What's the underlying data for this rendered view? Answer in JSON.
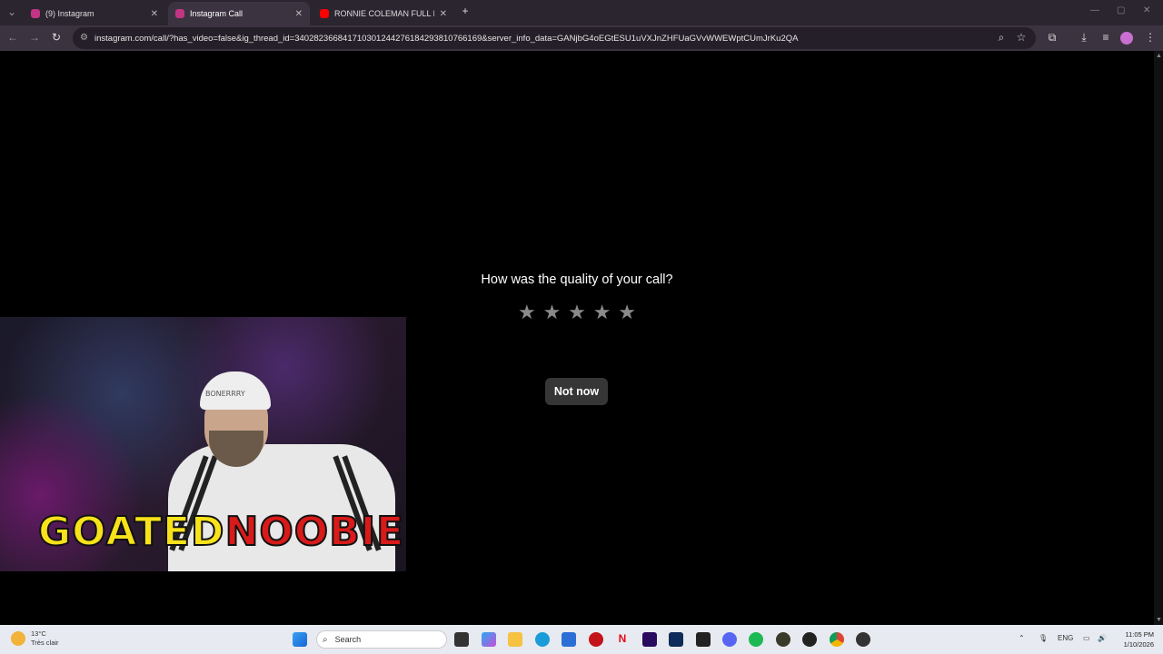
{
  "browser": {
    "tabs": [
      {
        "title": "(9) Instagram",
        "favicon_color": "#c13584"
      },
      {
        "title": "Instagram Call",
        "favicon_color": "#c13584"
      },
      {
        "title": "RONNIE COLEMAN FULL DAY O",
        "favicon_color": "#ff0000"
      }
    ],
    "new_tab": "+",
    "close_glyph": "✕",
    "url": "instagram.com/call/?has_video=false&ig_thread_id=340282366841710301244276184293810766169&server_info_data=GANjbG4oEGtESU1uVXJnZHFUaGVvWWEWptCUmJrKu2QA"
  },
  "call_rating": {
    "question": "How was the quality of your call?",
    "stars": [
      "★",
      "★",
      "★",
      "★",
      "★"
    ],
    "dismiss_label": "Not now"
  },
  "overlay": {
    "logo_part1": "GOATED",
    "logo_part2": "NOOBIE",
    "cap_text": "BONERRRY"
  },
  "taskbar": {
    "weather_temp": "13°C",
    "weather_desc": "Très clair",
    "search_label": "Search",
    "language": "ENG",
    "time": "11:05 PM",
    "date": "1/10/2026"
  }
}
